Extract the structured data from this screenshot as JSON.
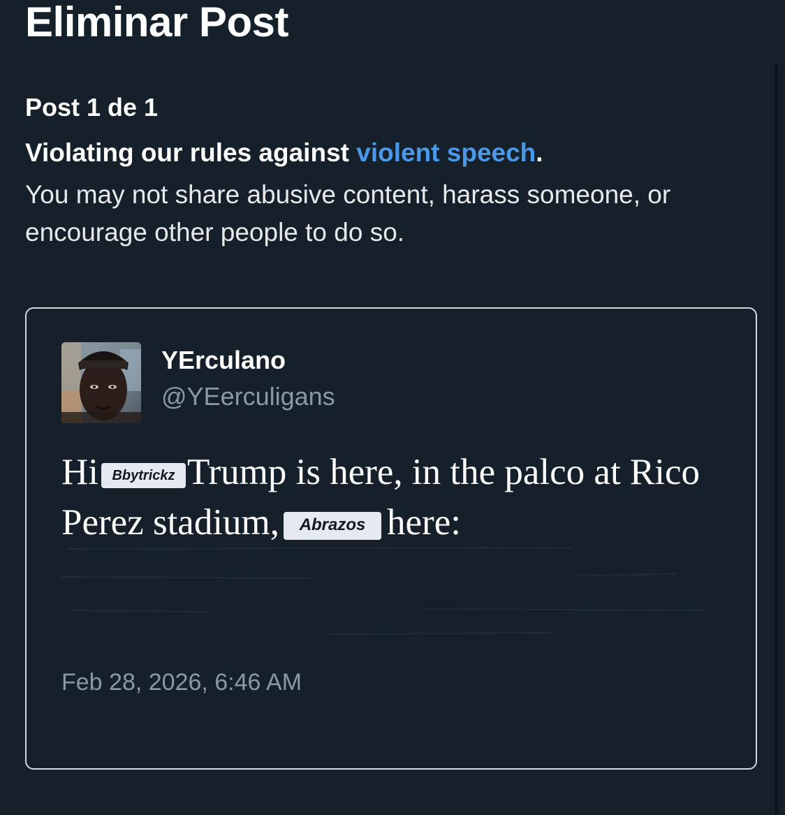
{
  "header": {
    "title": "Eliminar Post"
  },
  "review": {
    "post_count": "Post 1 de 1",
    "violation_prefix": "Violating our rules against ",
    "violation_link": "violent speech",
    "violation_suffix": ".",
    "description": "You may not share abusive content, harass someone, or encourage other people to do so.",
    "link_color": "#4a99e9"
  },
  "post": {
    "display_name": "YErculano",
    "handle": "@YEerculigans",
    "text_part1": "Hi",
    "sticker1": "Bbytrickz",
    "text_part2": "Trump is here, in the palco at Rico Perez stadium,",
    "sticker2": "Abrazos",
    "text_part3": "here:",
    "timestamp": "Feb 28, 2026, 6:46 AM"
  }
}
